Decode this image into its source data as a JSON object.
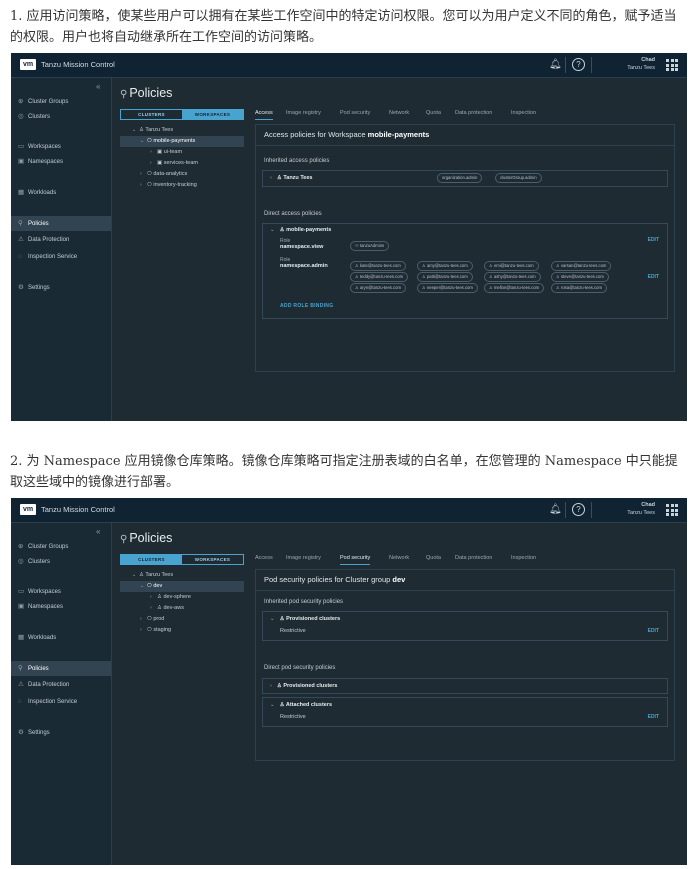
{
  "para1": "1. 应用访问策略，使某些用户可以拥有在某些工作空间中的特定访问权限。您可以为用户定义不同的角色，赋予适当的权限。用户也将自动继承所在工作空间的访问策略。",
  "para2": "2. 为 Namespace 应用镜像仓库策略。镜像仓库策略可指定注册表域的白名单，在您管理的 Namespace 中只能提取这些域中的镜像进行部署。",
  "app": {
    "logo": "vm",
    "title": "Tanzu Mission Control",
    "user_name": "Chad",
    "user_org": "Tanzu Tees"
  },
  "icons": {
    "bell": "bell-icon",
    "help": "help-icon",
    "apps": "apps-grid-icon"
  },
  "sidebar": {
    "items": [
      {
        "icon": "cluster-groups-icon",
        "glyph": "⊕",
        "label": "Cluster Groups"
      },
      {
        "icon": "clusters-icon",
        "glyph": "◎",
        "label": "Clusters"
      },
      {
        "icon": "workspaces-icon",
        "glyph": "▭",
        "label": "Workspaces"
      },
      {
        "icon": "namespaces-icon",
        "glyph": "▣",
        "label": "Namespaces"
      },
      {
        "icon": "workloads-icon",
        "glyph": "▦",
        "label": "Workloads"
      },
      {
        "icon": "policies-icon",
        "glyph": "⚲",
        "label": "Policies"
      },
      {
        "icon": "data-protection-icon",
        "glyph": "⚠",
        "label": "Data Protection"
      },
      {
        "icon": "inspection-icon",
        "glyph": "◌",
        "label": "Inspection Service"
      },
      {
        "icon": "settings-icon",
        "glyph": "⚙",
        "label": "Settings"
      }
    ]
  },
  "policies": {
    "title": "Policies",
    "seg_clusters": "CLUSTERS",
    "seg_workspaces": "WORKSPACES",
    "tabs": [
      "Access",
      "Image registry",
      "Pod security",
      "Network",
      "Quota",
      "Data protection",
      "Inspection"
    ]
  },
  "shot1": {
    "tree": [
      {
        "chev": "⌄",
        "label": "Tanzu Tees",
        "glyph": "♙"
      },
      {
        "chev": "⌄",
        "label": "mobile-payments",
        "glyph": "⎔"
      },
      {
        "chev": "›",
        "label": "ui-team",
        "glyph": "▣"
      },
      {
        "chev": "›",
        "label": "services-team",
        "glyph": "▣"
      },
      {
        "chev": "›",
        "label": "data-analytics",
        "glyph": "⎔"
      },
      {
        "chev": "›",
        "label": "inventory-tracking",
        "glyph": "⎔"
      }
    ],
    "panel_prefix": "Access policies for Workspace ",
    "panel_target": "mobile-payments",
    "inherited_title": "Inherited access policies",
    "inherited_row": "Tanzu Tees",
    "inherited_chips": [
      "organization.admin",
      "clusterGroup.admin"
    ],
    "direct_title": "Direct access policies",
    "direct_group": "mobile-payments",
    "role_label": "Role",
    "role1": "namespace.view",
    "role1_chips": [
      "tanzuAdmins"
    ],
    "role2": "namespace.admin",
    "role2_chips": [
      "kate@tanzu-tees.com",
      "amy@tanzu-tees.com",
      "emi@tanzu-tees.com",
      "varsan@tanzu-tees.com",
      "teddy@tanzu-tees.com",
      "patti@tanzu-tees.com",
      "ashy@tanzu-tees.com",
      "steve@tanzu-tees.com",
      "aryn@tanzu-tees.com",
      "neeper@tanzu-tees.com",
      "mellon@tanzu-tees.com",
      "rosa@tanzu-tees.com"
    ],
    "edit": "EDIT",
    "add_role": "ADD ROLE BINDING"
  },
  "shot2": {
    "tree": [
      {
        "chev": "⌄",
        "label": "Tanzu Tees",
        "glyph": "♙"
      },
      {
        "chev": "⌄",
        "label": "dev",
        "glyph": "⎔"
      },
      {
        "chev": "›",
        "label": "dev-sphere",
        "glyph": "♙"
      },
      {
        "chev": "›",
        "label": "dev-aws",
        "glyph": "♙"
      },
      {
        "chev": "›",
        "label": "prod",
        "glyph": "⎔"
      },
      {
        "chev": "›",
        "label": "staging",
        "glyph": "⎔"
      }
    ],
    "panel_prefix": "Pod security policies for Cluster group ",
    "panel_target": "dev",
    "inherited_title": "Inherited pod security policies",
    "prov_row": "Provisioned clusters",
    "restrictive": "Restrictive",
    "direct_title": "Direct pod security policies",
    "direct_prov": "Provisioned clusters",
    "attached": "Attached clusters",
    "edit": "EDIT"
  }
}
